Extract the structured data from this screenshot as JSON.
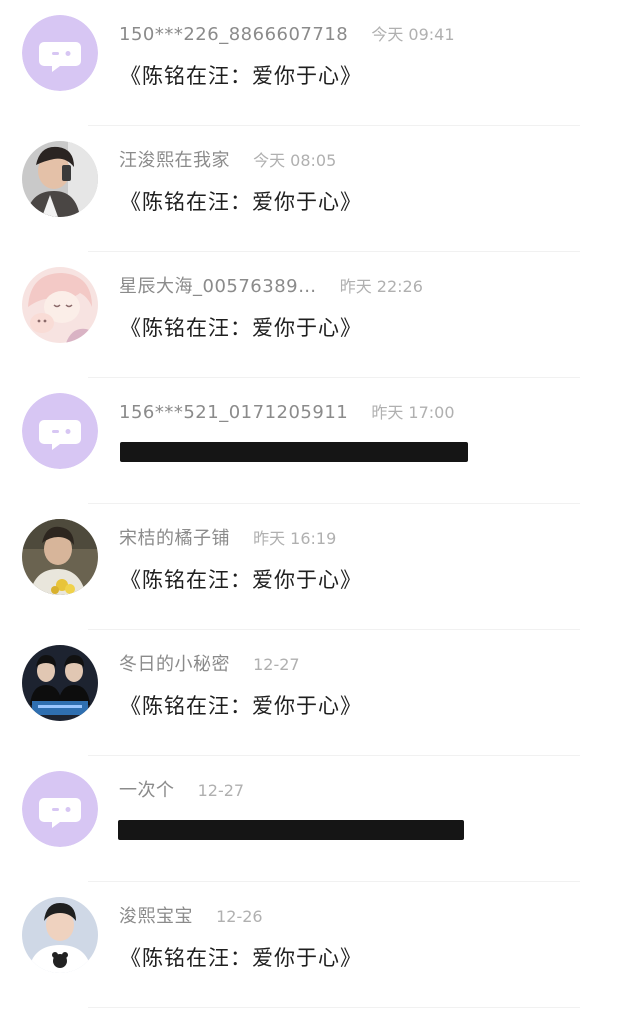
{
  "conversations": [
    {
      "name": "150***226_8866607718",
      "time": "今天 09:41",
      "message": "《陈铭在汪：爱你于心》",
      "avatar": "default-chat-bubble-icon",
      "redacted": false
    },
    {
      "name": "汪浚熙在我家",
      "time": "今天 08:05",
      "message": "《陈铭在汪：爱你于心》",
      "avatar": "photo-person-phone",
      "redacted": false
    },
    {
      "name": "星辰大海_00576389…",
      "time": "昨天 22:26",
      "message": "《陈铭在汪：爱你于心》",
      "avatar": "anime-girl-illustration",
      "redacted": false
    },
    {
      "name": "156***521_0171205911",
      "time": "昨天 17:00",
      "message": "",
      "avatar": "default-chat-bubble-icon",
      "redacted": true
    },
    {
      "name": "宋桔的橘子铺",
      "time": "昨天 16:19",
      "message": "《陈铭在汪：爱你于心》",
      "avatar": "photo-person-flowers",
      "redacted": false
    },
    {
      "name": "冬日的小秘密",
      "time": "12-27",
      "message": "《陈铭在汪：爱你于心》",
      "avatar": "photo-two-people-poster",
      "redacted": false
    },
    {
      "name": "一次个",
      "time": "12-27",
      "message": "",
      "avatar": "default-chat-bubble-icon",
      "redacted": true
    },
    {
      "name": "浚熙宝宝",
      "time": "12-26",
      "message": "《陈铭在汪：爱你于心》",
      "avatar": "photo-person-bear-shirt",
      "redacted": false
    }
  ],
  "colors": {
    "default_avatar_bg": "#d7c6f3",
    "name_text": "#8b8b8b",
    "time_text": "#b0b0b0",
    "message_text": "#1f1f1f",
    "redaction": "#151515"
  }
}
